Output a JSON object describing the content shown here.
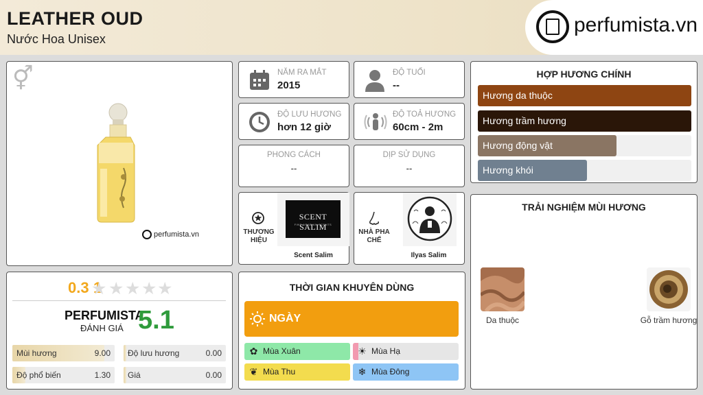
{
  "product": {
    "name": "LEATHER OUD",
    "subtitle": "Nước Hoa Unisex",
    "image_watermark": "perfumista.vn"
  },
  "brand_logo": {
    "text": "perfumista.vn"
  },
  "info": {
    "release_year": {
      "label": "NĂM RA MẮT",
      "value": "2015",
      "icon": "calendar-icon"
    },
    "age": {
      "label": "ĐỘ TUỔI",
      "value": "--",
      "icon": "person-icon"
    },
    "longevity": {
      "label": "ĐỘ LƯU HƯƠNG",
      "value": "hơn 12 giờ",
      "icon": "clock-icon"
    },
    "sillage": {
      "label": "ĐỘ TOẢ HƯƠNG",
      "value": "60cm - 2m",
      "icon": "sillage-icon"
    },
    "style": {
      "label": "PHONG CÁCH",
      "value": "--"
    },
    "occasion": {
      "label": "DỊP SỬ DỤNG",
      "value": "--"
    },
    "brand": {
      "label": "THƯƠNG HIỆU",
      "name": "Scent Salim",
      "logo_text": "SCENT SALIM",
      "logo_sub": "FINE ARABIAN SCENTS",
      "icon": "star-icon"
    },
    "perfumer": {
      "label": "NHÀ PHA CHẾ",
      "name": "Ilyas Salim",
      "icon": "nose-icon"
    }
  },
  "accords": {
    "title": "HỢP HƯƠNG CHÍNH",
    "items": [
      {
        "label": "Hương da thuộc",
        "value": 1.0,
        "color": "#8e4512"
      },
      {
        "label": "Hương trầm hương",
        "value": 1.0,
        "color": "#2a1608"
      },
      {
        "label": "Hương động vật",
        "value": 0.65,
        "color": "#8a7563"
      },
      {
        "label": "Hương khói",
        "value": 0.51,
        "color": "#708090"
      }
    ]
  },
  "experience": {
    "title": "TRẢI NGHIỆM MÙI HƯƠNG",
    "notes": [
      {
        "label": "Da thuộc"
      },
      {
        "label": "Gỗ trầm hương"
      }
    ]
  },
  "rating": {
    "user_score": "0.3",
    "user_score_suffix": "1",
    "stars_total": 5,
    "perfumista_label": "PERFUMISTA",
    "perfumista_sub": "ĐÁNH GIÁ",
    "perfumista_score": "5.1",
    "stats": [
      {
        "name": "Mùi hương",
        "value": "9.00",
        "fraction": 0.9
      },
      {
        "name": "Độ lưu hương",
        "value": "0.00",
        "fraction": 0.0
      },
      {
        "name": "Độ phổ biến",
        "value": "1.30",
        "fraction": 0.13
      },
      {
        "name": "Giá",
        "value": "0.00",
        "fraction": 0.0
      }
    ]
  },
  "recommended_time": {
    "title": "THỜI GIAN KHUYÊN DÙNG",
    "day_label": "NGÀY",
    "seasons": [
      {
        "label": "Mùa Xuân",
        "color": "#8ee8a8"
      },
      {
        "label": "Mùa Hạ",
        "color": "#e6e6e6",
        "accent": "#f29ab0"
      },
      {
        "label": "Mùa Thu",
        "color": "#f3dc4e"
      },
      {
        "label": "Mùa Đông",
        "color": "#8ec5f5"
      }
    ]
  }
}
